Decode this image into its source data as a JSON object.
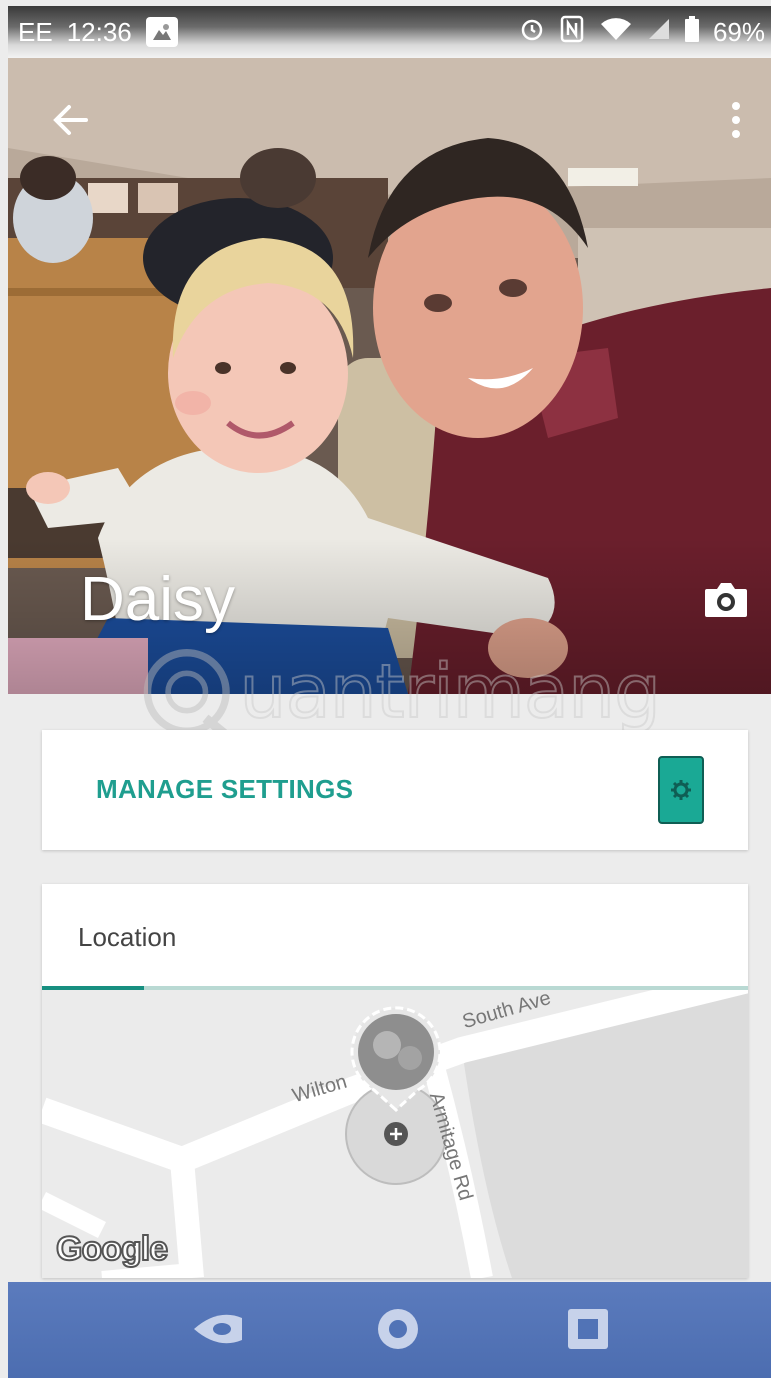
{
  "status_bar": {
    "carrier": "EE",
    "time": "12:36",
    "battery": "69%"
  },
  "profile": {
    "name": "Daisy"
  },
  "manage_card": {
    "label": "MANAGE SETTINGS"
  },
  "location_card": {
    "title": "Location",
    "map_labels": {
      "street_1": "South Ave",
      "street_2": "Wilton",
      "street_3": "Armitage Rd"
    },
    "attribution": "Google"
  },
  "watermark": {
    "text": "uantrimang"
  },
  "colors": {
    "accent": "#1f9e8f",
    "nav_bar": "#5173b6"
  },
  "icons": {
    "back": "arrow-back-icon",
    "more": "more-vert-icon",
    "camera": "camera-icon",
    "device_settings": "phone-gear-icon",
    "nav_back": "nav-back-icon",
    "nav_home": "nav-home-icon",
    "nav_recents": "nav-recents-icon"
  }
}
